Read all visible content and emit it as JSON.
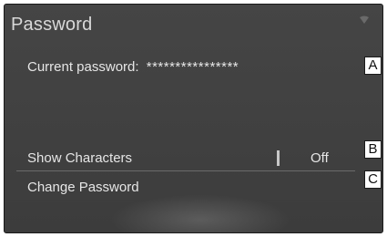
{
  "screen": {
    "title": "Password",
    "current_password_label": "Current password:",
    "current_password_value": "****************",
    "icons": {
      "signal": "signal-icon"
    }
  },
  "rows": {
    "show_characters": {
      "label": "Show Characters",
      "value": "Off"
    },
    "change_password": {
      "label": "Change Password"
    }
  },
  "callouts": {
    "a": "A",
    "b": "B",
    "c": "C"
  }
}
